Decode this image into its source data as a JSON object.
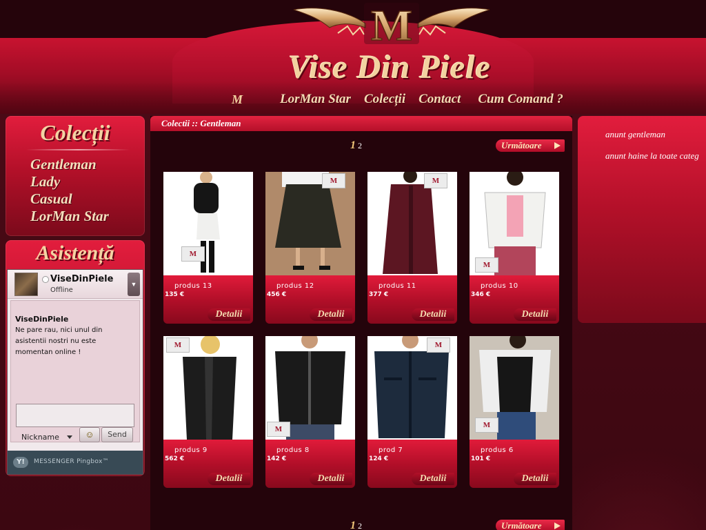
{
  "header": {
    "logo_letter": "M",
    "site_title": "Vise Din Piele",
    "nav_logo": "M",
    "nav": [
      "LorMan Star",
      "Colecții",
      "Contact",
      "Cum Comand ?"
    ]
  },
  "sidebar": {
    "colectii_title": "Colecții",
    "categories": [
      "Gentleman",
      "Lady",
      "Casual",
      "LorMan Star"
    ],
    "asistenta_title": "Asistență"
  },
  "pingbox": {
    "name": "ViseDinPiele",
    "status": "Offline",
    "msg_name": "ViseDinPiele",
    "msg_text": "Ne pare rau, nici unul din asistentii nostri nu este momentan online !",
    "nickname_label": "Nickname",
    "send_label": "Send",
    "footer_text": "MESSENGER Pingbox™",
    "footer_logo": "Y!"
  },
  "main": {
    "breadcrumb": "Colectii :: Gentleman",
    "pager_current": "1",
    "pager_next_page": "2",
    "next_label": "Următoare",
    "detail_label": "Detalii",
    "products": [
      {
        "name": "produs 13",
        "price": "135 €"
      },
      {
        "name": "produs 12",
        "price": "456 €"
      },
      {
        "name": "produs 11",
        "price": "377 €"
      },
      {
        "name": "produs 10",
        "price": "346 €"
      },
      {
        "name": "produs 9",
        "price": "562 €"
      },
      {
        "name": "produs 8",
        "price": "142 €"
      },
      {
        "name": "prod 7",
        "price": "124 €"
      },
      {
        "name": "produs 6",
        "price": "101 €"
      }
    ]
  },
  "right": {
    "ads": [
      "anunt gentleman",
      "anunt haine la toate categ"
    ]
  },
  "colors": {
    "accent_red": "#c81330",
    "dark_bg": "#24040b",
    "gold_text": "#f2d2a0"
  }
}
